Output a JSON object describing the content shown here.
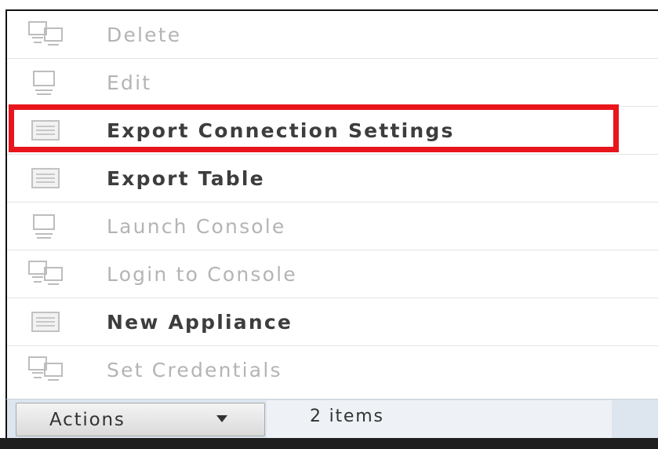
{
  "menu": {
    "items": [
      {
        "label": "Delete",
        "icon": "multi-monitor-icon",
        "enabled": false
      },
      {
        "label": "Edit",
        "icon": "monitor-icon",
        "enabled": false
      },
      {
        "label": "Export Connection Settings",
        "icon": "document-icon",
        "enabled": true,
        "highlighted": true
      },
      {
        "label": "Export Table",
        "icon": "document-icon",
        "enabled": true
      },
      {
        "label": "Launch Console",
        "icon": "monitor-icon",
        "enabled": false
      },
      {
        "label": "Login to Console",
        "icon": "multi-monitor-icon",
        "enabled": false
      },
      {
        "label": "New Appliance",
        "icon": "document-icon",
        "enabled": true
      },
      {
        "label": "Set Credentials",
        "icon": "multi-monitor-icon",
        "enabled": false
      }
    ]
  },
  "toolbar": {
    "actions_label": "Actions",
    "item_count": "2 items"
  },
  "colors": {
    "highlight": "#e8161c",
    "disabled_text": "#b4b4b4",
    "enabled_text": "#3d3d3d",
    "toolbar_bg": "#dde6ef"
  }
}
